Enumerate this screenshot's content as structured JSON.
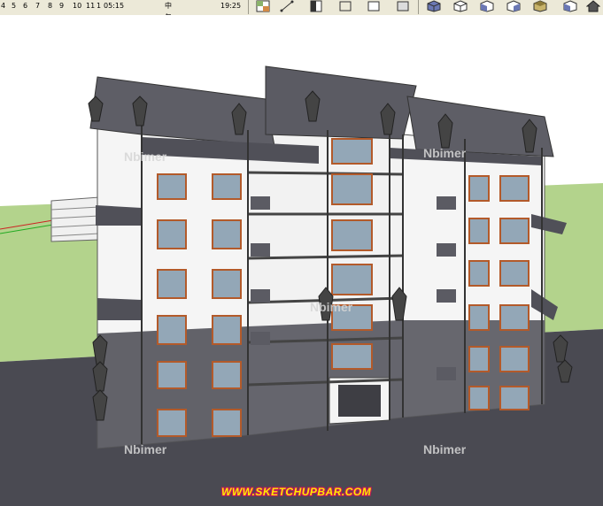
{
  "toolbar": {
    "ruler_ticks": [
      "4",
      "5",
      "6",
      "7",
      "8",
      "9",
      "10",
      "11",
      "1",
      "05:15"
    ],
    "time_of_day_label": "中午",
    "time_value": "19:25",
    "view_tools": [
      {
        "name": "materials",
        "icon": "materials-icon"
      },
      {
        "name": "dimensions",
        "icon": "dimensions-icon"
      },
      {
        "name": "xray",
        "icon": "xray-icon"
      },
      {
        "name": "wireframe",
        "icon": "wireframe-icon"
      },
      {
        "name": "hidden-line",
        "icon": "hidden-line-icon"
      },
      {
        "name": "shaded",
        "icon": "shaded-icon"
      },
      {
        "name": "iso-view",
        "icon": "iso-cube-icon"
      },
      {
        "name": "top-view",
        "icon": "top-cube-icon"
      },
      {
        "name": "front-view",
        "icon": "front-cube-icon"
      },
      {
        "name": "right-view",
        "icon": "right-cube-icon"
      },
      {
        "name": "back-view",
        "icon": "back-cube-icon"
      },
      {
        "name": "left-view",
        "icon": "left-cube-icon"
      }
    ]
  },
  "viewport": {
    "watermarks": [
      {
        "text": "Nbimer"
      },
      {
        "text": "Nbimer"
      },
      {
        "text": "Nbimer"
      },
      {
        "text": "Nbimer"
      },
      {
        "text": "Nbimer"
      }
    ],
    "site_url": "WWW.SKETCHUPBAR.COM",
    "colors": {
      "sky": "#ffffff",
      "ground": "#b3d38c",
      "pavement": "#4a4a52",
      "roof": "#5e5e66",
      "wall": "#f5f5f5",
      "base": "#55555c",
      "window_frame": "#b35a2a",
      "glass": "#93a7b7"
    }
  }
}
